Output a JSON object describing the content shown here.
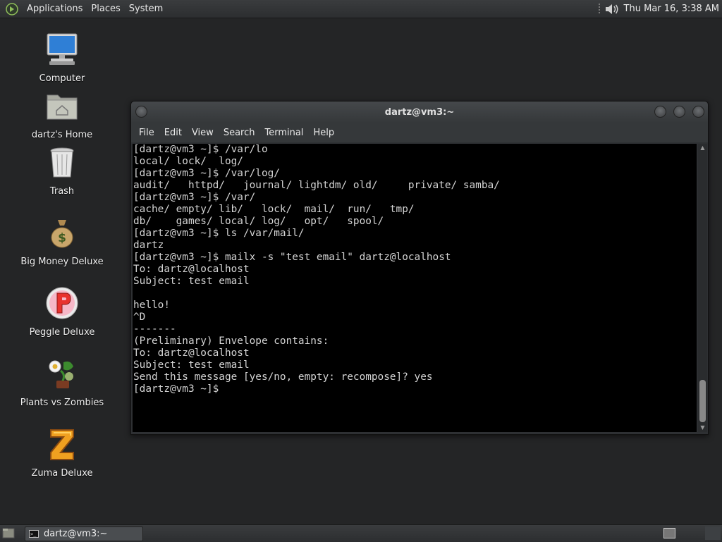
{
  "top_panel": {
    "menus": [
      "Applications",
      "Places",
      "System"
    ],
    "clock": "Thu Mar 16,  3:38 AM"
  },
  "desktop_icons": [
    {
      "label": "Computer",
      "icon": "computer-icon"
    },
    {
      "label": "dartz's Home",
      "icon": "home-folder-icon"
    },
    {
      "label": "Trash",
      "icon": "trash-icon"
    },
    {
      "label": "Big Money Deluxe",
      "icon": "money-bag-icon"
    },
    {
      "label": "Peggle Deluxe",
      "icon": "peggle-icon"
    },
    {
      "label": "Plants vs Zombies",
      "icon": "plants-vs-zombies-icon"
    },
    {
      "label": "Zuma Deluxe",
      "icon": "zuma-icon"
    }
  ],
  "terminal": {
    "title": "dartz@vm3:~",
    "menus": [
      "File",
      "Edit",
      "View",
      "Search",
      "Terminal",
      "Help"
    ],
    "lines": [
      "[dartz@vm3 ~]$ /var/lo",
      "local/ lock/  log/",
      "[dartz@vm3 ~]$ /var/log/",
      "audit/   httpd/   journal/ lightdm/ old/     private/ samba/",
      "[dartz@vm3 ~]$ /var/",
      "cache/ empty/ lib/   lock/  mail/  run/   tmp/",
      "db/    games/ local/ log/   opt/   spool/",
      "[dartz@vm3 ~]$ ls /var/mail/",
      "dartz",
      "[dartz@vm3 ~]$ mailx -s \"test email\" dartz@localhost",
      "To: dartz@localhost",
      "Subject: test email",
      "",
      "hello!",
      "^D",
      "-------",
      "(Preliminary) Envelope contains:",
      "To: dartz@localhost",
      "Subject: test email",
      "Send this message [yes/no, empty: recompose]? yes",
      "[dartz@vm3 ~]$ "
    ]
  },
  "taskbar": {
    "window_label": "dartz@vm3:~"
  }
}
